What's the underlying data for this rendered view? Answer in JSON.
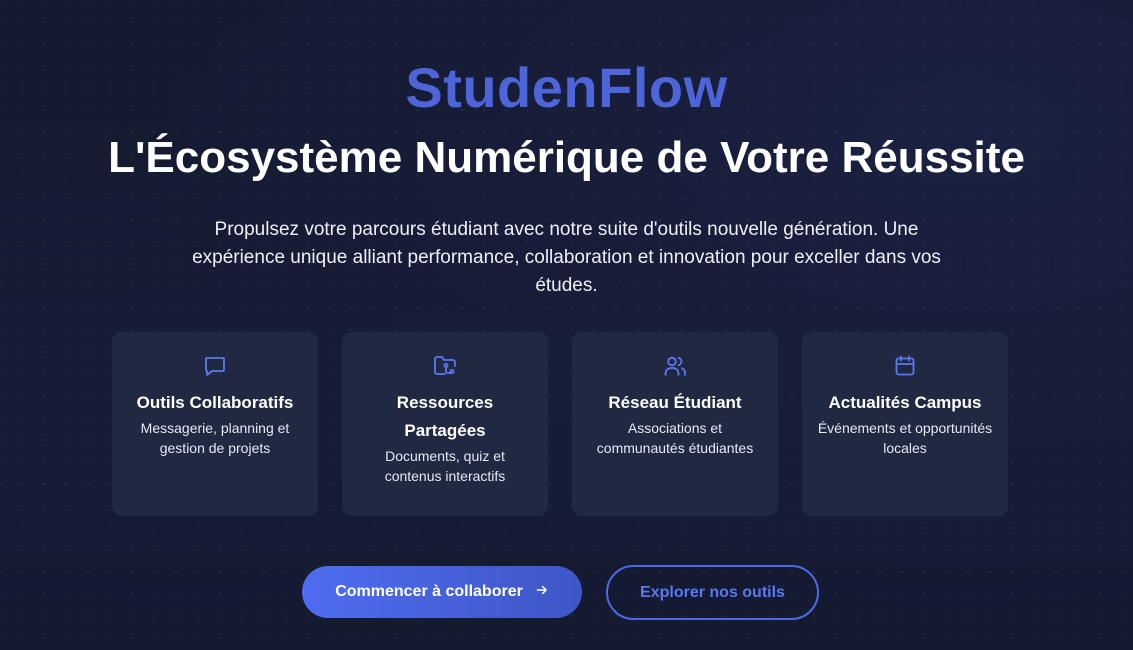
{
  "hero": {
    "brand": "StudenFlow",
    "headline": "L'Écosystème Numérique de Votre Réussite",
    "lead": "Propulsez votre parcours étudiant avec notre suite d'outils nouvelle génération. Une expérience unique alliant performance, collaboration et innovation pour exceller dans vos études."
  },
  "features": [
    {
      "icon": "chat-bubble-icon",
      "title": "Outils Collaboratifs",
      "desc": "Messagerie, planning et gestion de projets"
    },
    {
      "icon": "shared-folder-icon",
      "title": "Ressources Partagées",
      "desc": "Documents, quiz et contenus interactifs"
    },
    {
      "icon": "users-icon",
      "title": "Réseau Étudiant",
      "desc": "Associations et communautés étudiantes"
    },
    {
      "icon": "calendar-icon",
      "title": "Actualités Campus",
      "desc": "Événements et opportunités locales"
    }
  ],
  "cta": {
    "primary_label": "Commencer à collaborer",
    "primary_icon": "arrow-right-icon",
    "secondary_label": "Explorer nos outils"
  },
  "colors": {
    "brand": "#4d65d8",
    "accent": "#5b78f2",
    "background": "#141a30",
    "card": "#212841"
  }
}
